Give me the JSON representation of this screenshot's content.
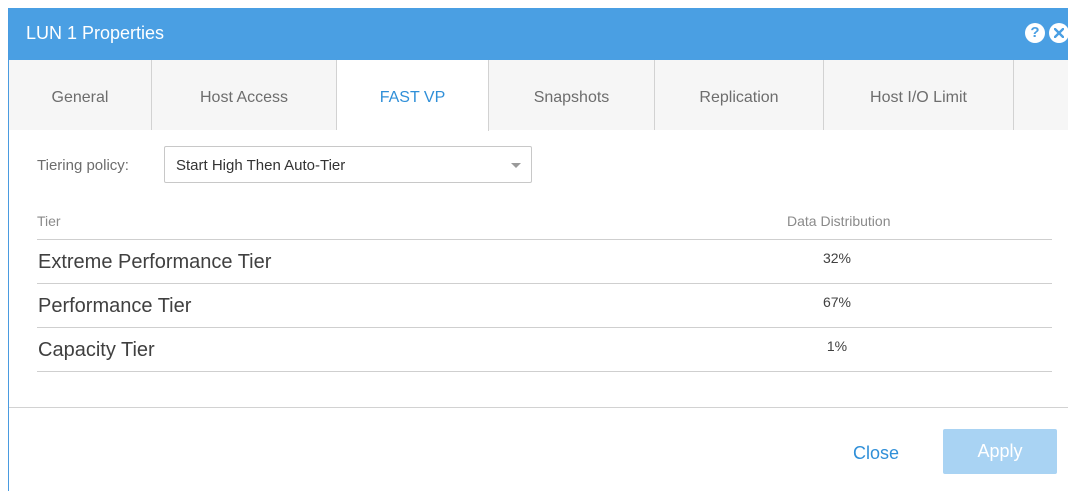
{
  "dialog": {
    "title": "LUN 1 Properties",
    "help_glyph": "?",
    "icons": {
      "help": "help-icon",
      "close": "close-icon",
      "dropdown": "chevron-down-icon"
    }
  },
  "tabs": [
    {
      "label": "General",
      "active": false
    },
    {
      "label": "Host Access",
      "active": false
    },
    {
      "label": "FAST VP",
      "active": true
    },
    {
      "label": "Snapshots",
      "active": false
    },
    {
      "label": "Replication",
      "active": false
    },
    {
      "label": "Host I/O Limit",
      "active": false
    }
  ],
  "tiering": {
    "label": "Tiering policy:",
    "selected": "Start High Then Auto-Tier"
  },
  "table": {
    "headers": {
      "tier": "Tier",
      "distribution": "Data Distribution"
    },
    "rows": [
      {
        "tier": "Extreme Performance Tier",
        "distribution": "32%"
      },
      {
        "tier": "Performance Tier",
        "distribution": "67%"
      },
      {
        "tier": "Capacity Tier",
        "distribution": "1%"
      }
    ]
  },
  "footer": {
    "close_label": "Close",
    "apply_label": "Apply",
    "apply_enabled": false
  },
  "colors": {
    "titlebar": "#4a9fe3",
    "accent": "#2f8fd8",
    "apply_disabled": "#a9d3f3"
  }
}
